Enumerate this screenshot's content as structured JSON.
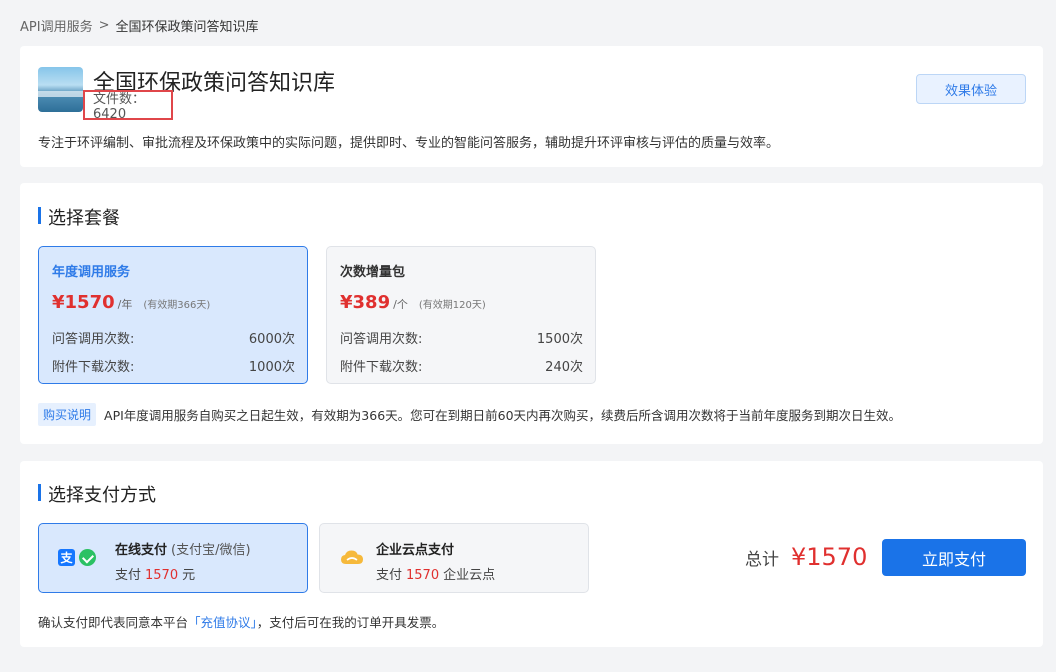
{
  "breadcrumb": {
    "parent": "API调用服务",
    "separator": ">",
    "current": "全国环保政策问答知识库"
  },
  "kb": {
    "title": "全国环保政策问答知识库",
    "file_count": "文件数：6420",
    "description": "专注于环评编制、审批流程及环保政策中的实际问题，提供即时、专业的智能问答服务，辅助提升环评审核与评估的质量与效率。",
    "try_label": "效果体验"
  },
  "plan_section": {
    "title": "选择套餐",
    "plans": [
      {
        "name": "年度调用服务",
        "price": "¥1570",
        "unit": "/年",
        "valid": "(有效期366天)",
        "qa_label": "问答调用次数:",
        "qa_value": "6000次",
        "dl_label": "附件下载次数:",
        "dl_value": "1000次",
        "selected": true
      },
      {
        "name": "次数增量包",
        "price": "¥389",
        "unit": "/个",
        "valid": "(有效期120天)",
        "qa_label": "问答调用次数:",
        "qa_value": "1500次",
        "dl_label": "附件下载次数:",
        "dl_value": "240次",
        "selected": false
      }
    ],
    "note_tag": "购买说明",
    "note_text": "API年度调用服务自购买之日起生效，有效期为366天。您可在到期日前60天内再次购买，续费后所含调用次数将于当前年度服务到期次日生效。"
  },
  "pay_section": {
    "title": "选择支付方式",
    "methods": [
      {
        "title": "在线支付",
        "sub": "(支付宝/微信)",
        "prefix": "支付",
        "amount": "1570",
        "suffix": "元",
        "icons": [
          "alipay-icon",
          "wechat-icon"
        ],
        "selected": true
      },
      {
        "title": "企业云点支付",
        "sub": "",
        "prefix": "支付",
        "amount": "1570",
        "suffix": "企业云点",
        "icons": [
          "cloud-icon"
        ],
        "selected": false
      }
    ],
    "total_label": "总计",
    "total_value": "¥1570",
    "pay_button": "立即支付",
    "agree_prefix": "确认支付即代表同意本平台",
    "agree_link": "「充值协议」",
    "agree_suffix": "，支付后可在我的订单开具发票。"
  },
  "colors": {
    "accent": "#1a73e8",
    "price": "#e0302f",
    "highlight_box": "#e0464a"
  }
}
